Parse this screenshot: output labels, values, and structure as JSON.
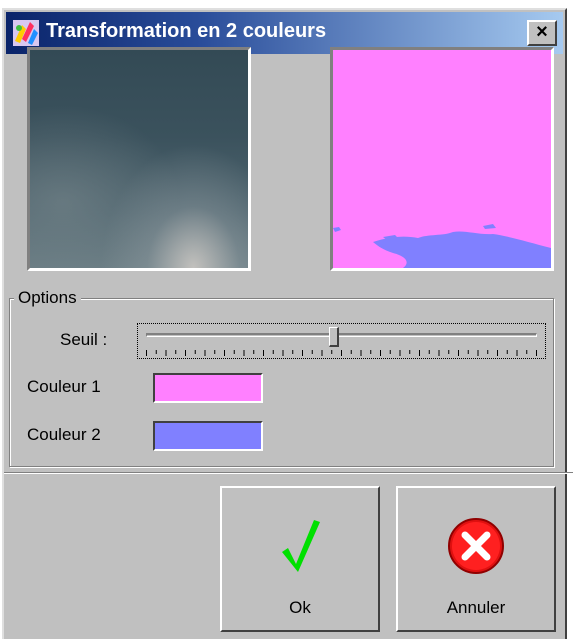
{
  "window": {
    "title": "Transformation en 2 couleurs",
    "close_label": "×",
    "app_icon": "paint-palette-icon"
  },
  "options": {
    "group_label": "Options",
    "threshold_label": "Seuil :",
    "threshold_value_fraction": 0.48,
    "color1_label": "Couleur 1",
    "color1": "#ff80ff",
    "color2_label": "Couleur 2",
    "color2": "#8080ff"
  },
  "buttons": {
    "ok_label": "Ok",
    "ok_icon": "green-checkmark-icon",
    "cancel_label": "Annuler",
    "cancel_icon": "red-x-circle-icon"
  }
}
